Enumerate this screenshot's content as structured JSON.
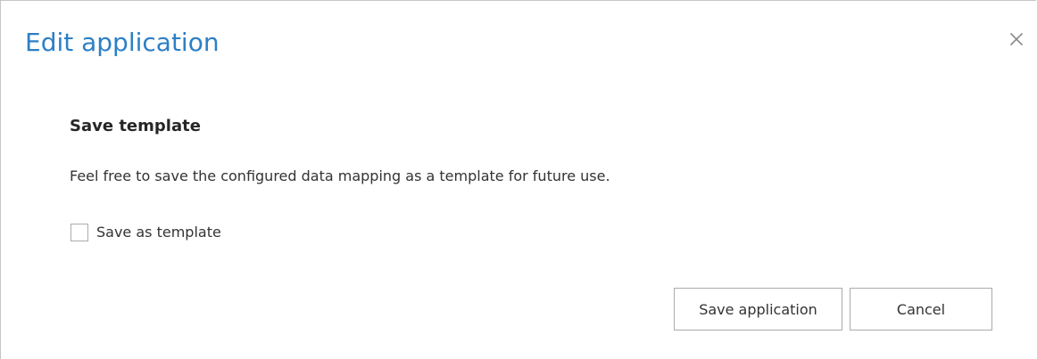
{
  "dialog": {
    "title": "Edit application",
    "close_icon": "close-icon"
  },
  "section": {
    "heading": "Save template",
    "description": "Feel free to save the configured data mapping as a template for future use."
  },
  "save_as_template": {
    "label": "Save as template",
    "checked": false
  },
  "actions": {
    "save_label": "Save application",
    "cancel_label": "Cancel"
  },
  "colors": {
    "title": "#2d7fc5",
    "border": "#ababab"
  }
}
